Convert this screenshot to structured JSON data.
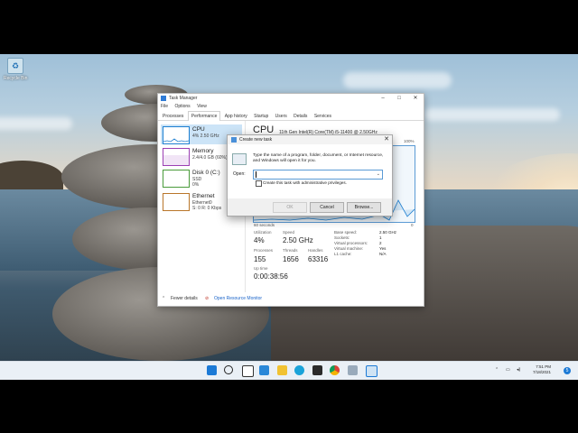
{
  "desktop": {
    "recycle_bin_label": "Recycle Bin"
  },
  "task_manager": {
    "title": "Task Manager",
    "menu": [
      "File",
      "Options",
      "View"
    ],
    "tabs": [
      "Processes",
      "Performance",
      "App history",
      "Startup",
      "Users",
      "Details",
      "Services"
    ],
    "active_tab": "Performance",
    "resources": [
      {
        "name": "CPU",
        "sub1": "4% 2.50 GHz",
        "sub2": "",
        "color": "#1d7fd1"
      },
      {
        "name": "Memory",
        "sub1": "2.4/4.0 GB (60%)",
        "sub2": "",
        "color": "#9b3fb3"
      },
      {
        "name": "Disk 0 (C:)",
        "sub1": "SSD",
        "sub2": "0%",
        "color": "#4a9b3a"
      },
      {
        "name": "Ethernet",
        "sub1": "Ethernet0",
        "sub2": "S: 0 R: 0 Kbps",
        "color": "#b9762a"
      }
    ],
    "cpu": {
      "title": "CPU",
      "model": "11th Gen Intel(R) Core(TM) i5-11400 @ 2.50GHz",
      "graph_max": "100%",
      "graph_min": "0",
      "graph_time": "60 seconds",
      "utilization_label": "Utilization",
      "utilization": "4%",
      "speed_label": "Speed",
      "speed": "2.50 GHz",
      "processes_label": "Processes",
      "processes": "155",
      "threads_label": "Threads",
      "threads": "1656",
      "handles_label": "Handles",
      "handles": "63316",
      "uptime_label": "Up time",
      "uptime": "0:00:38:56",
      "details": [
        {
          "label": "Base speed:",
          "value": "2.50 GHz"
        },
        {
          "label": "Sockets:",
          "value": "1"
        },
        {
          "label": "Virtual processors:",
          "value": "2"
        },
        {
          "label": "Virtual machine:",
          "value": "Yes"
        },
        {
          "label": "L1 cache:",
          "value": "N/A"
        }
      ]
    },
    "footer": {
      "fewer_details": "Fewer details",
      "open_monitor": "Open Resource Monitor"
    }
  },
  "dialog": {
    "title": "Create new task",
    "description": "Type the name of a program, folder, document, or Internet resource, and Windows will open it for you.",
    "open_label": "Open:",
    "open_value": "",
    "admin_checkbox_label": "Create this task with administrative privileges.",
    "ok_label": "OK",
    "cancel_label": "Cancel",
    "browse_label": "Browse..."
  },
  "taskbar": {
    "time": "7:51 PM",
    "date": "7/18/2021",
    "notification_count": "5",
    "pinned": [
      "start",
      "search",
      "task-view",
      "widgets",
      "file-explorer",
      "edge",
      "store",
      "chrome",
      "app",
      "task-manager"
    ]
  }
}
